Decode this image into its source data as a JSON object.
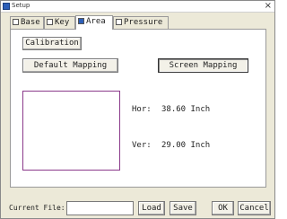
{
  "window": {
    "title": "Setup",
    "close_glyph": "×"
  },
  "tabs": [
    {
      "label": "Base",
      "icon": "base-icon"
    },
    {
      "label": "Key",
      "icon": "key-icon"
    },
    {
      "label": "Area",
      "icon": "area-icon",
      "active": true
    },
    {
      "label": "Pressure",
      "icon": "pressure-icon"
    }
  ],
  "area": {
    "calibration_label": "Calibration",
    "default_mapping_label": "Default Mapping",
    "screen_mapping_label": "Screen Mapping",
    "hor_label": "Hor:",
    "hor_value": "38.60 Inch",
    "ver_label": "Ver:",
    "ver_value": "29.00 Inch"
  },
  "footer": {
    "current_file_label": "Current File:",
    "current_file_value": "",
    "load_label": "Load",
    "save_label": "Save",
    "ok_label": "OK",
    "cancel_label": "Cancel"
  }
}
